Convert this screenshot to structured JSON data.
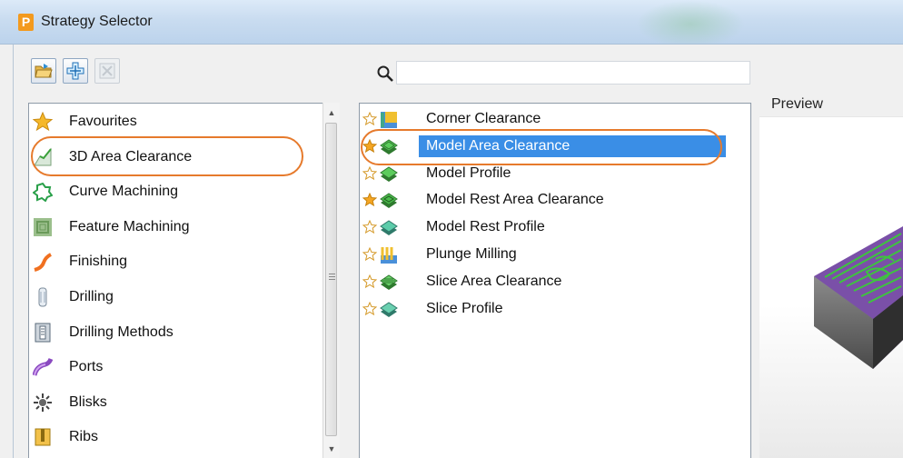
{
  "window": {
    "title": "Strategy Selector",
    "app_icon_letter": "P"
  },
  "toolbar": {
    "buttons": [
      {
        "icon": "open-folder-icon",
        "enabled": true
      },
      {
        "icon": "add-crosshair-icon",
        "enabled": true
      },
      {
        "icon": "delete-icon",
        "enabled": false
      }
    ]
  },
  "search": {
    "value": "",
    "placeholder": ""
  },
  "categories": [
    {
      "label": "Favourites",
      "icon": "favourites-star-icon"
    },
    {
      "label": "3D Area Clearance",
      "icon": "3d-area-clearance-icon",
      "selected": true
    },
    {
      "label": "Curve Machining",
      "icon": "curve-machining-icon"
    },
    {
      "label": "Feature Machining",
      "icon": "feature-machining-icon"
    },
    {
      "label": "Finishing",
      "icon": "finishing-icon"
    },
    {
      "label": "Drilling",
      "icon": "drilling-icon"
    },
    {
      "label": "Drilling Methods",
      "icon": "drilling-methods-icon"
    },
    {
      "label": "Ports",
      "icon": "ports-icon"
    },
    {
      "label": "Blisks",
      "icon": "blisks-icon"
    },
    {
      "label": "Ribs",
      "icon": "ribs-icon"
    }
  ],
  "strategies": [
    {
      "label": "Corner Clearance",
      "favourite": false,
      "icon": "corner-clearance-icon"
    },
    {
      "label": "Model Area Clearance",
      "favourite": true,
      "selected": true,
      "icon": "model-area-clearance-icon"
    },
    {
      "label": "Model Profile",
      "favourite": false,
      "icon": "model-profile-icon"
    },
    {
      "label": "Model Rest Area Clearance",
      "favourite": true,
      "icon": "model-rest-area-clearance-icon"
    },
    {
      "label": "Model Rest Profile",
      "favourite": false,
      "icon": "model-rest-profile-icon"
    },
    {
      "label": "Plunge Milling",
      "favourite": false,
      "icon": "plunge-milling-icon"
    },
    {
      "label": "Slice Area Clearance",
      "favourite": false,
      "icon": "slice-area-clearance-icon"
    },
    {
      "label": "Slice Profile",
      "favourite": false,
      "icon": "slice-profile-icon"
    }
  ],
  "preview": {
    "label": "Preview"
  },
  "colors": {
    "selection": "#3a8ee6",
    "highlight_oval": "#e67a2c",
    "favourite_star": "#f5a623"
  }
}
